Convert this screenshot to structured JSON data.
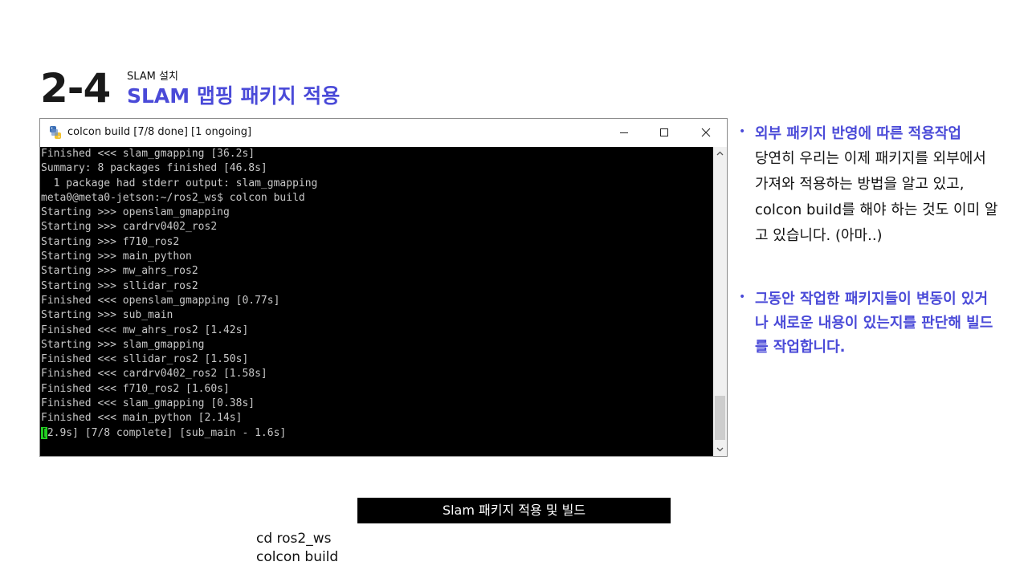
{
  "section": {
    "number": "2-4",
    "subtitle": "SLAM 설치",
    "title": "SLAM 맵핑 패키지 적용"
  },
  "terminal_window": {
    "title": "colcon build [7/8 done] [1 ongoing]",
    "icons": {
      "app": "python-icon",
      "minimize": "minimize-icon",
      "maximize": "maximize-icon",
      "close": "close-icon"
    },
    "lines": [
      "Finished <<< slam_gmapping [36.2s]",
      "",
      "Summary: 8 packages finished [46.8s]",
      "  1 package had stderr output: slam_gmapping",
      "meta0@meta0-jetson:~/ros2_ws$ colcon build",
      "Starting >>> openslam_gmapping",
      "Starting >>> cardrv0402_ros2",
      "Starting >>> f710_ros2",
      "Starting >>> main_python",
      "Starting >>> mw_ahrs_ros2",
      "Starting >>> sllidar_ros2",
      "Finished <<< openslam_gmapping [0.77s]",
      "Starting >>> sub_main",
      "Finished <<< mw_ahrs_ros2 [1.42s]",
      "Starting >>> slam_gmapping",
      "Finished <<< sllidar_ros2 [1.50s]",
      "Finished <<< cardrv0402_ros2 [1.58s]",
      "Finished <<< f710_ros2 [1.60s]",
      "Finished <<< slam_gmapping [0.38s]",
      "Finished <<< main_python [2.14s]"
    ],
    "progress_line": {
      "cursor": "[",
      "text": "2.9s] [7/8 complete] [sub_main - 1.6s]"
    },
    "colors": {
      "background": "#000000",
      "text": "#c8c8c8",
      "cursor": "#22d022"
    }
  },
  "notes": [
    {
      "heading": "외부 패키지 반영에 따른 적용작업",
      "body": "당연히 우리는 이제 패키지를 외부에서 가져와 적용하는 방법을 알고 있고, colcon build를 해야 하는 것도 이미 알고 있습니다. (아마..)"
    },
    {
      "heading": "그동안 작업한 패키지들이 변동이 있거나 새로운 내용이 있는지를 판단해 빌드를 작업합니다."
    }
  ],
  "caption": "Slam 패키지 적용 및 빌드",
  "commands": [
    "cd ros2_ws",
    "colcon build"
  ],
  "colors": {
    "accent": "#4a4ad8"
  }
}
